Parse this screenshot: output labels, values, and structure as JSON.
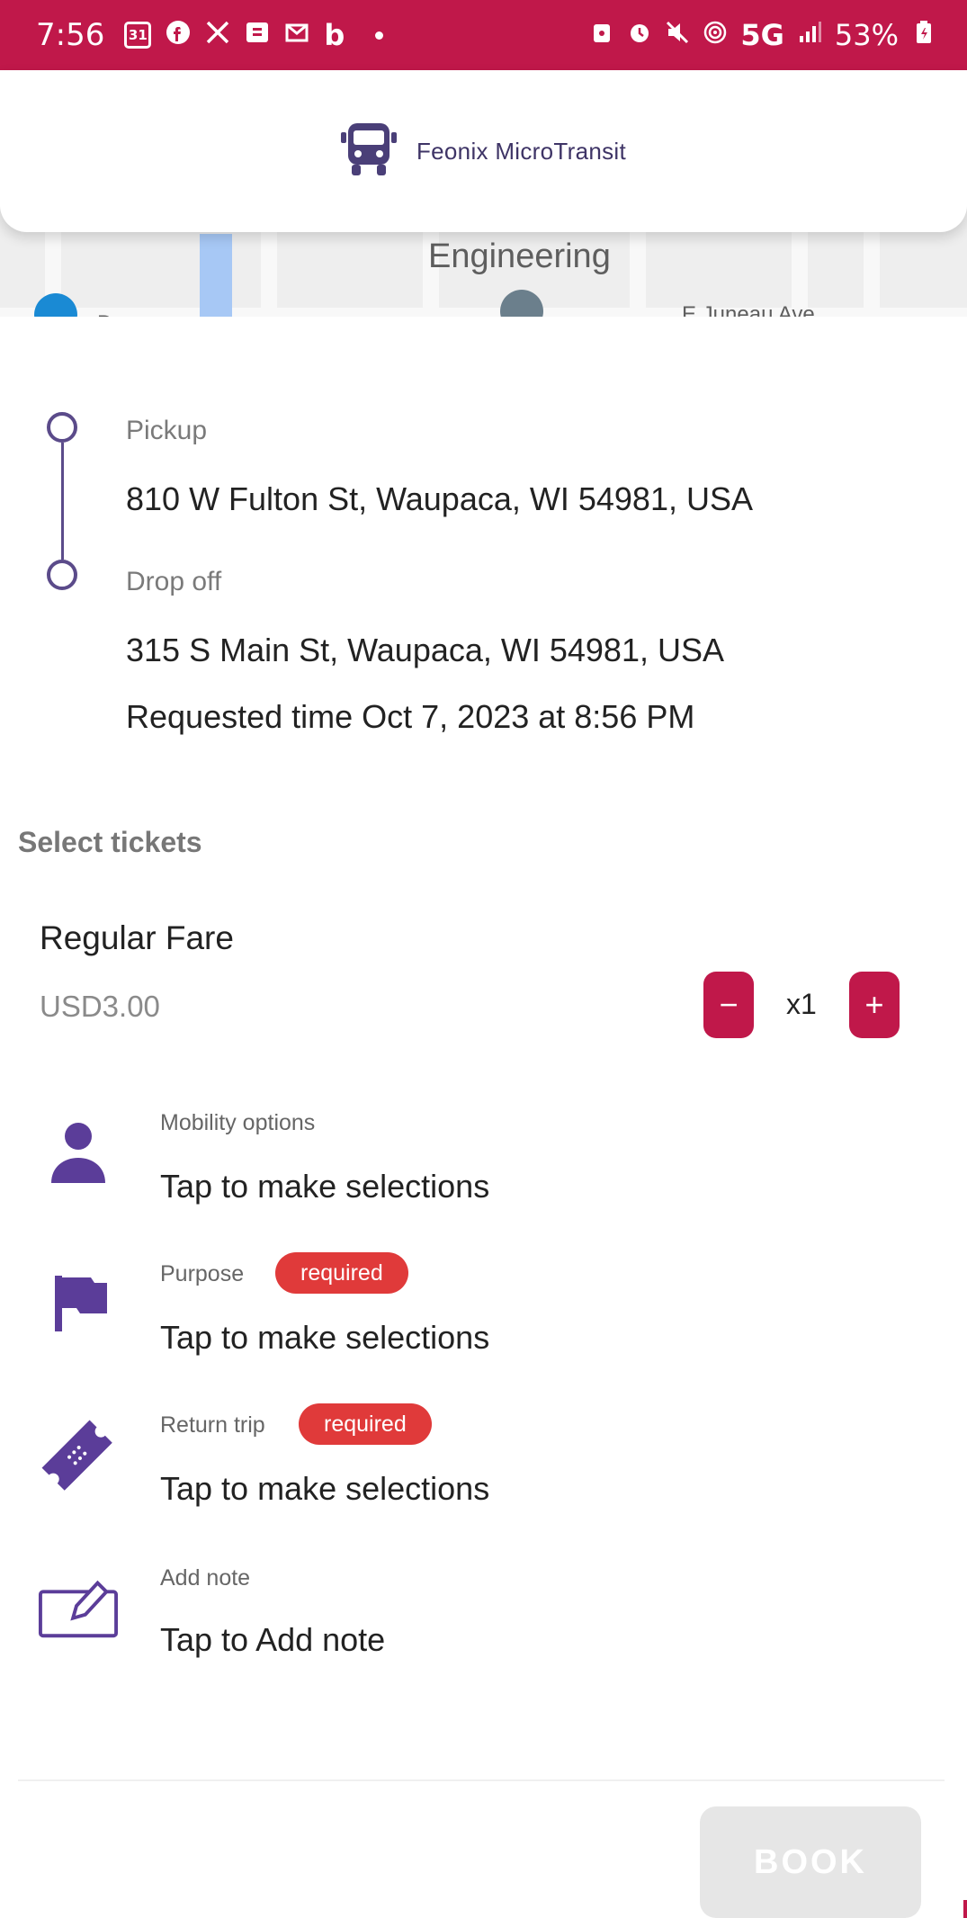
{
  "status_bar": {
    "time": "7:56",
    "calendar_day": "31",
    "network": "5G",
    "battery": "53%"
  },
  "header": {
    "title": "Feonix MicroTransit",
    "icon": "bus-icon"
  },
  "map": {
    "labels": [
      "Engineering",
      "E Juneau Ave",
      "D"
    ]
  },
  "trip": {
    "pickup_label": "Pickup",
    "pickup_address": "810 W Fulton St, Waupaca, WI 54981, USA",
    "dropoff_label": "Drop off",
    "dropoff_address": "315 S Main St, Waupaca, WI 54981, USA",
    "requested_time": "Requested time Oct 7, 2023 at 8:56 PM"
  },
  "tickets": {
    "section_title": "Select tickets",
    "fare_name": "Regular Fare",
    "fare_price": "USD3.00",
    "quantity": "x1",
    "minus": "−",
    "plus": "+"
  },
  "options": [
    {
      "label": "Mobility options",
      "value": "Tap to make selections",
      "icon": "person-icon",
      "required": ""
    },
    {
      "label": "Purpose",
      "value": "Tap to make selections",
      "icon": "flag-icon",
      "required": "required"
    },
    {
      "label": "Return trip",
      "value": "Tap to make selections",
      "icon": "ticket-icon",
      "required": "required"
    },
    {
      "label": "Add note",
      "value": "Tap to Add note",
      "icon": "edit-note-icon",
      "required": ""
    }
  ],
  "footer": {
    "book_label": "BOOK"
  },
  "colors": {
    "brand": "#c0184a",
    "accent": "#5b4b8a",
    "required": "#e03a3a"
  }
}
